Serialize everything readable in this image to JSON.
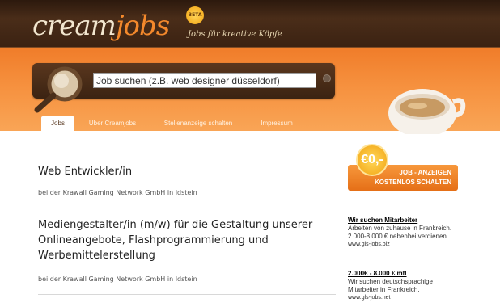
{
  "header": {
    "logo_cream": "cream",
    "logo_jobs": "jobs",
    "beta": "BETA",
    "tagline": "Jobs für kreative Köpfe"
  },
  "search": {
    "value": "Job suchen (z.B. web designer düsseldorf)"
  },
  "nav": {
    "tabs": [
      {
        "label": "Jobs",
        "active": true
      },
      {
        "label": "Über Creamjobs",
        "active": false
      },
      {
        "label": "Stellenanzeige schalten",
        "active": false
      },
      {
        "label": "Impressum",
        "active": false
      }
    ]
  },
  "jobs": [
    {
      "title": "Web Entwickler/in",
      "company": "bei der Krawall Gaming Network GmbH in Idstein"
    },
    {
      "title_lines": [
        "Mediengestalter/in (m/w) für die Gestaltung unserer",
        "Onlineangebote, Flashprogrammierung und",
        "Werbemittelerstellung"
      ],
      "company": "bei der Krawall Gaming Network GmbH in Idstein"
    }
  ],
  "promo": {
    "coin": "€0,-",
    "line1": "JOB - ANZEIGEN",
    "line2": "KOSTENLOS SCHALTEN"
  },
  "ads": [
    {
      "title": "Wir suchen Mitarbeiter",
      "line1": "Arbeiten von zuhause in Frankreich.",
      "line2": "2.000-8.000 € nebenbei verdienen.",
      "url": "www.gls-jobs.biz"
    },
    {
      "title": "2.000€ - 8.000 € mtl",
      "line1": "Wir suchen deutschsprachige",
      "line2": "Mitarbeiter in Frankreich.",
      "url": "www.gls-jobs.net"
    }
  ],
  "colors": {
    "brown": "#3a2314",
    "orange": "#f07d2a",
    "cream": "#f2e6cf"
  }
}
